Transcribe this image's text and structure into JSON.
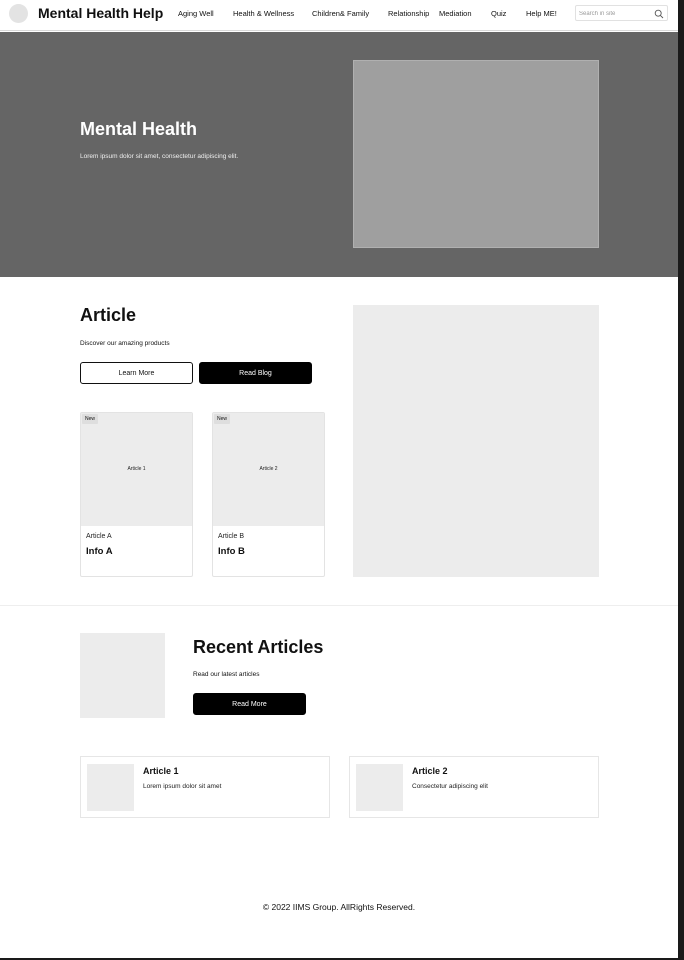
{
  "header": {
    "site_title": "Mental Health Help",
    "nav": [
      {
        "label": "Aging Well"
      },
      {
        "label": "Health & Wellness"
      },
      {
        "label": "Children& Family"
      },
      {
        "label": "Relationship"
      },
      {
        "label": "Mediation"
      },
      {
        "label": "Quiz"
      },
      {
        "label": "Help ME!"
      }
    ],
    "search": {
      "placeholder": "Search in site",
      "icon": "search-icon"
    }
  },
  "hero": {
    "title": "Mental Health",
    "subtitle": "Lorem ipsum dolor sit amet, consectetur adipiscing elit."
  },
  "article": {
    "title": "Article",
    "subtitle": "Discover our amazing products",
    "learn_more_label": "Learn More",
    "read_blog_label": "Read Blog",
    "cards": [
      {
        "badge": "New",
        "image_label": "Article 1",
        "kicker": "Article A",
        "title": "Info A"
      },
      {
        "badge": "New",
        "image_label": "Article 2",
        "kicker": "Article B",
        "title": "Info B"
      }
    ]
  },
  "recent": {
    "title": "Recent Articles",
    "subtitle": "Read our latest articles",
    "read_more_label": "Read More",
    "items": [
      {
        "title": "Article 1",
        "text": "Lorem ipsum dolor sit amet"
      },
      {
        "title": "Article 2",
        "text": "Consectetur adipiscing elit"
      }
    ]
  },
  "footer": {
    "copyright": "© 2022 IIMS Group. AllRights Reserved."
  },
  "colors": {
    "hero_bg": "#656565",
    "placeholder": "#ececec",
    "primary_button": "#000000"
  }
}
